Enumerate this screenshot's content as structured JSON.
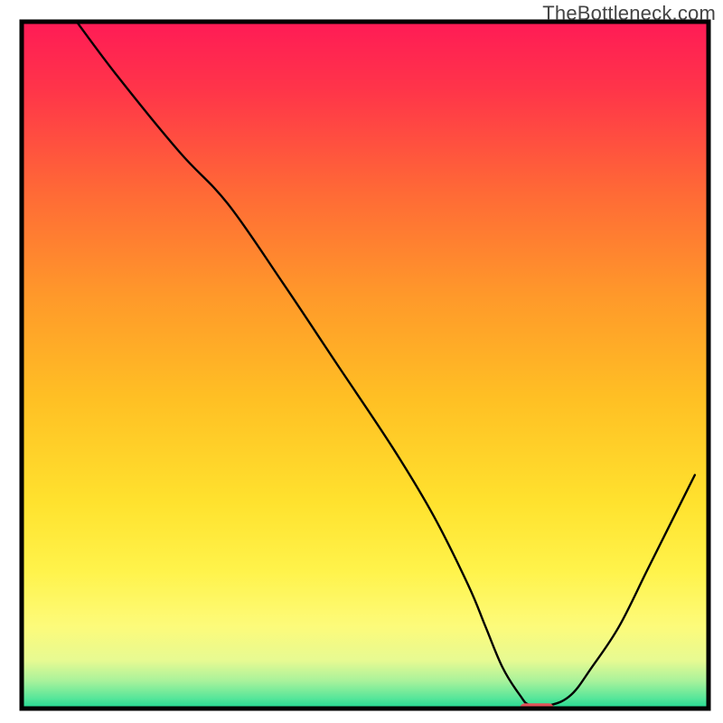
{
  "watermark": "TheBottleneck.com",
  "chart_data": {
    "type": "line",
    "title": "",
    "xlabel": "",
    "ylabel": "",
    "xlim": [
      0,
      100
    ],
    "ylim": [
      0,
      100
    ],
    "grid": false,
    "legend": null,
    "axes_visible": false,
    "background": {
      "type": "vertical-gradient",
      "stops": [
        {
          "pos": 0.0,
          "color": "#ff1b56"
        },
        {
          "pos": 0.1,
          "color": "#ff3549"
        },
        {
          "pos": 0.25,
          "color": "#ff6a36"
        },
        {
          "pos": 0.4,
          "color": "#ff992a"
        },
        {
          "pos": 0.55,
          "color": "#ffc024"
        },
        {
          "pos": 0.7,
          "color": "#ffe22e"
        },
        {
          "pos": 0.8,
          "color": "#fff34b"
        },
        {
          "pos": 0.88,
          "color": "#fdfb7a"
        },
        {
          "pos": 0.93,
          "color": "#e7fa92"
        },
        {
          "pos": 0.96,
          "color": "#a8f29b"
        },
        {
          "pos": 0.985,
          "color": "#57e69a"
        },
        {
          "pos": 1.0,
          "color": "#1fd893"
        }
      ]
    },
    "series": [
      {
        "name": "bottleneck-curve",
        "stroke": "#000000",
        "x": [
          8.0,
          14.0,
          23.0,
          30.0,
          38.0,
          46.0,
          54.0,
          60.0,
          65.0,
          67.5,
          70.0,
          72.5,
          74.0,
          77.0,
          80.0,
          83.0,
          87.0,
          91.0,
          95.0,
          98.0
        ],
        "values": [
          100.0,
          92.0,
          81.0,
          73.5,
          62.0,
          50.0,
          38.0,
          28.0,
          18.0,
          12.0,
          6.0,
          2.0,
          0.5,
          0.5,
          2.0,
          6.0,
          12.0,
          20.0,
          28.0,
          34.0
        ]
      }
    ],
    "markers": [
      {
        "name": "optimal-marker",
        "shape": "rounded-rect",
        "x": 75.0,
        "y": 0.0,
        "width_pct": 5.0,
        "height_pct": 1.5,
        "fill": "#e25259"
      }
    ]
  }
}
